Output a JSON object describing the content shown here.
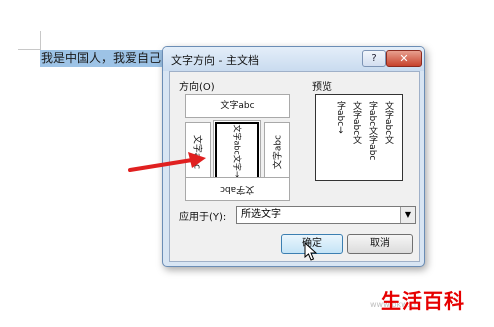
{
  "document": {
    "selected_text": "我是中国人，我爱自己的"
  },
  "dialog": {
    "title": "文字方向 - 主文档",
    "help_label": "?",
    "close_label": "✕",
    "orientation_label": "方向(O)",
    "preview_label": "预览",
    "options": {
      "horizontal": "文字abc",
      "vertical_right": "文字abc",
      "vertical_stacked": "文字abc文字→",
      "vertical_left": "文字abc",
      "horizontal_rotated": "文字abc"
    },
    "preview_columns": [
      "文字abc文",
      "字abc文字abc",
      "文字abc文",
      "字abc→"
    ],
    "apply_to_label": "应用于(Y):",
    "apply_to_value": "所选文字",
    "ok_label": "确定",
    "cancel_label": "取消"
  },
  "watermark": {
    "text": "生活百科"
  },
  "colors": {
    "selection": "#9dc3e6",
    "close_button": "#c7422c",
    "arrow": "#e02020",
    "watermark": "#e60000"
  }
}
